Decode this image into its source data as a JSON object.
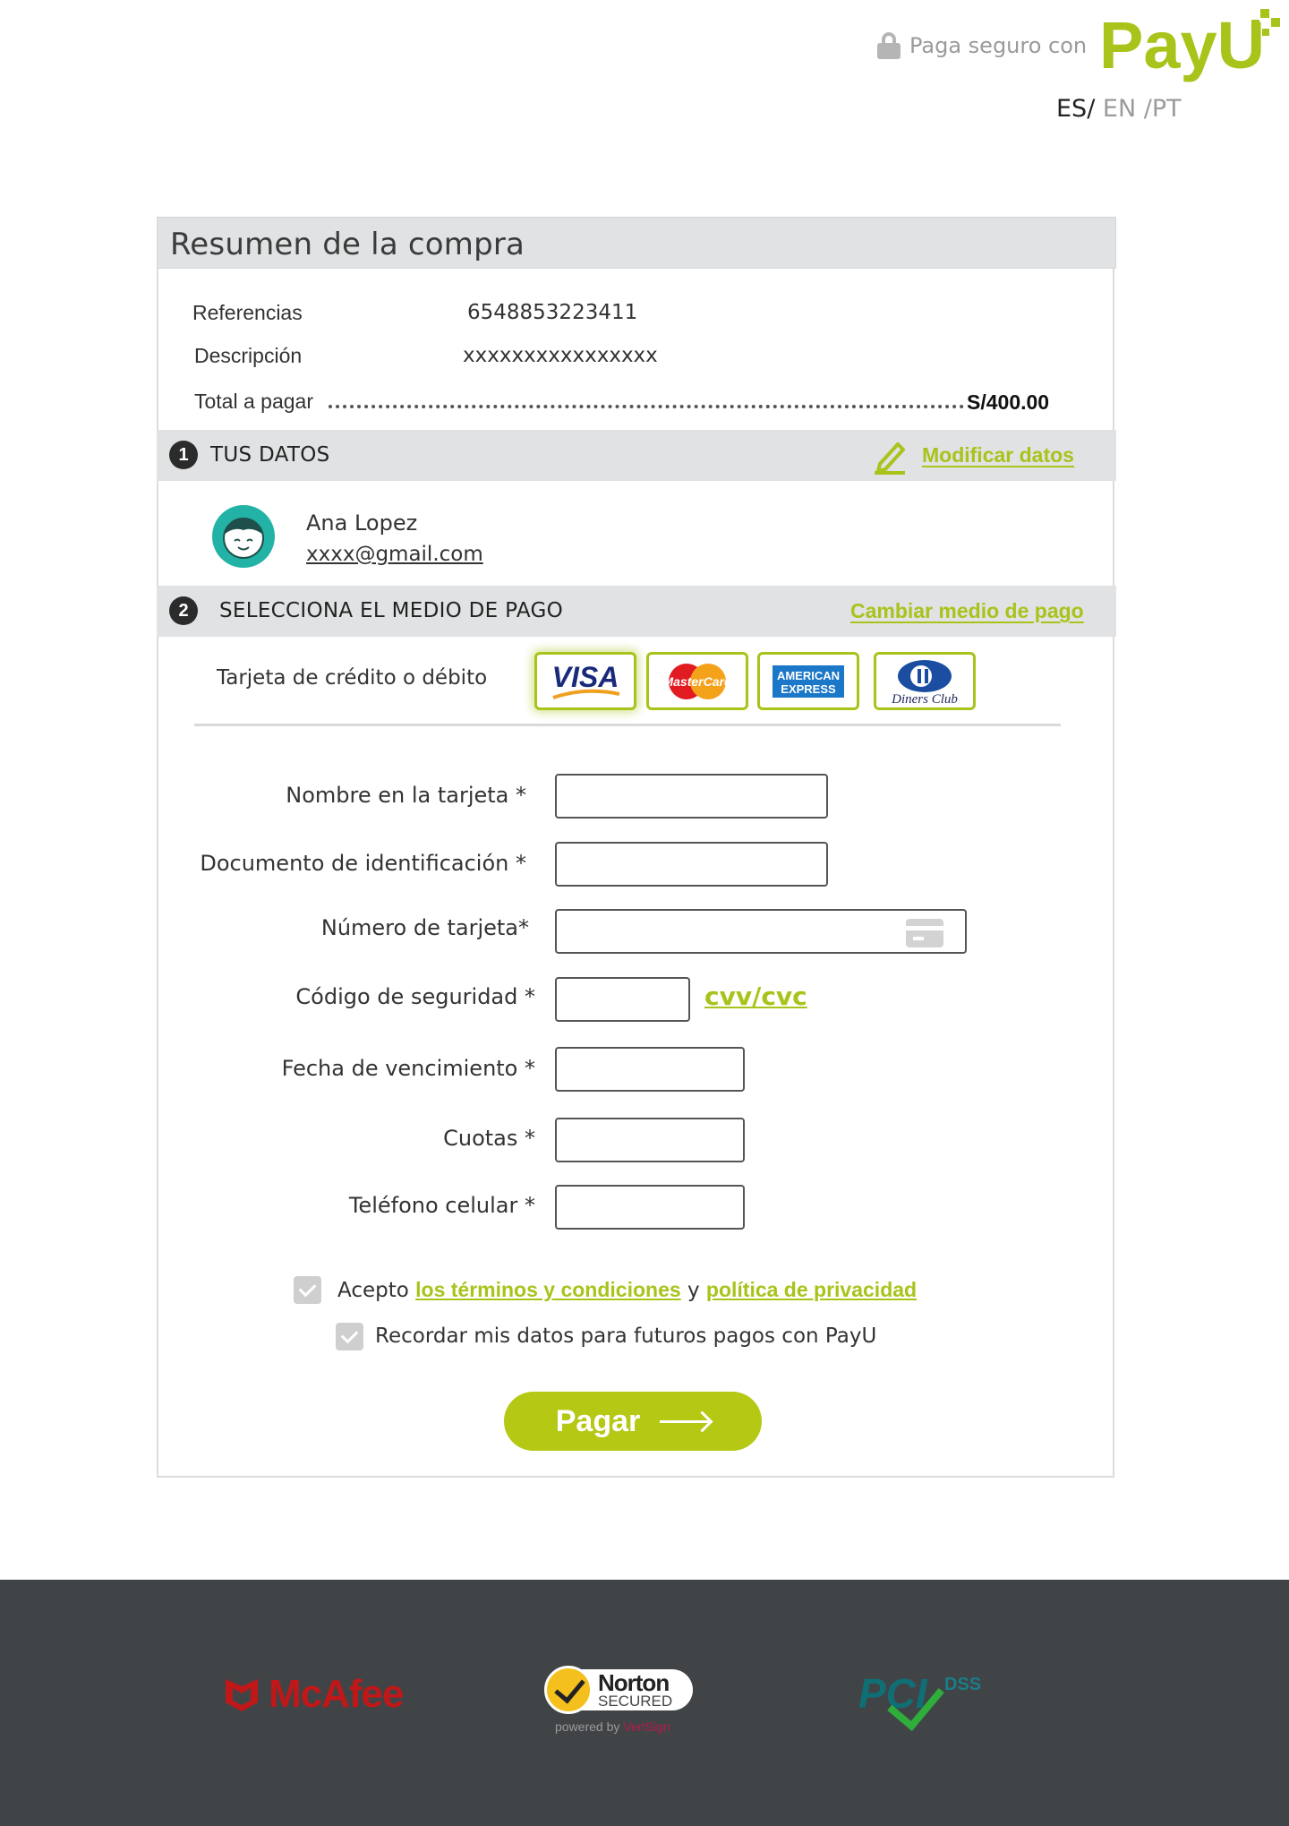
{
  "header": {
    "secure_text": "Paga seguro con",
    "brand": "PayU",
    "languages": {
      "active": "ES/",
      "en": " EN /",
      "pt": "PT"
    }
  },
  "summary": {
    "title": "Resumen de la compra",
    "reference_label": "Referencias",
    "reference_value": "6548853223411",
    "description_label": "Descripción",
    "description_value": "xxxxxxxxxxxxxxxx",
    "total_label": "Total a pagar",
    "total_value": "S/400.00"
  },
  "step1": {
    "number": "1",
    "title": "TUS DATOS",
    "edit_link": "Modificar datos",
    "user_name": "Ana Lopez",
    "user_email": "xxxx@gmail.com"
  },
  "step2": {
    "number": "2",
    "title": "SELECCIONA EL MEDIO DE PAGO",
    "change_link": "Cambiar medio de pago",
    "method_label": "Tarjeta de crédito o débito",
    "brands": {
      "visa": "VISA",
      "mastercard": "MasterCard",
      "amex_line1": "AMERICAN",
      "amex_line2": "EXPRESS",
      "diners": "Diners Club"
    }
  },
  "form": {
    "name_label": "Nombre en la tarjeta *",
    "name_value": "",
    "document_label": "Documento de identificación *",
    "document_value": "",
    "card_number_label": "Número de tarjeta*",
    "card_number_value": "",
    "security_code_label": "Código de seguridad *",
    "security_code_value": "",
    "cvv_link": "cvv/cvc",
    "expiry_label": "Fecha de vencimiento *",
    "expiry_value": "",
    "installments_label": "Cuotas *",
    "installments_value": "",
    "phone_label": "Teléfono celular *",
    "phone_value": ""
  },
  "consent": {
    "accept_prefix": "Acepto ",
    "terms_link": "los términos y condiciones",
    "and": " y ",
    "privacy_link": "política de privacidad",
    "remember_text": "Recordar mis datos para futuros pagos con PayU",
    "accept_checked": true,
    "remember_checked": true
  },
  "pay_button": "Pagar",
  "footer": {
    "mcafee": "McAfee",
    "norton_title": "Norton",
    "norton_sub": "SECURED",
    "norton_powered": "powered by ",
    "norton_powered_brand": "VeriSign",
    "pci": "PCI",
    "pci_dss": "DSS"
  },
  "colors": {
    "brand_green": "#a9c31b",
    "button_green": "#b4c814",
    "section_gray": "#e0e2e3",
    "footer_bg": "#404447",
    "avatar_teal": "#22b3a6"
  }
}
